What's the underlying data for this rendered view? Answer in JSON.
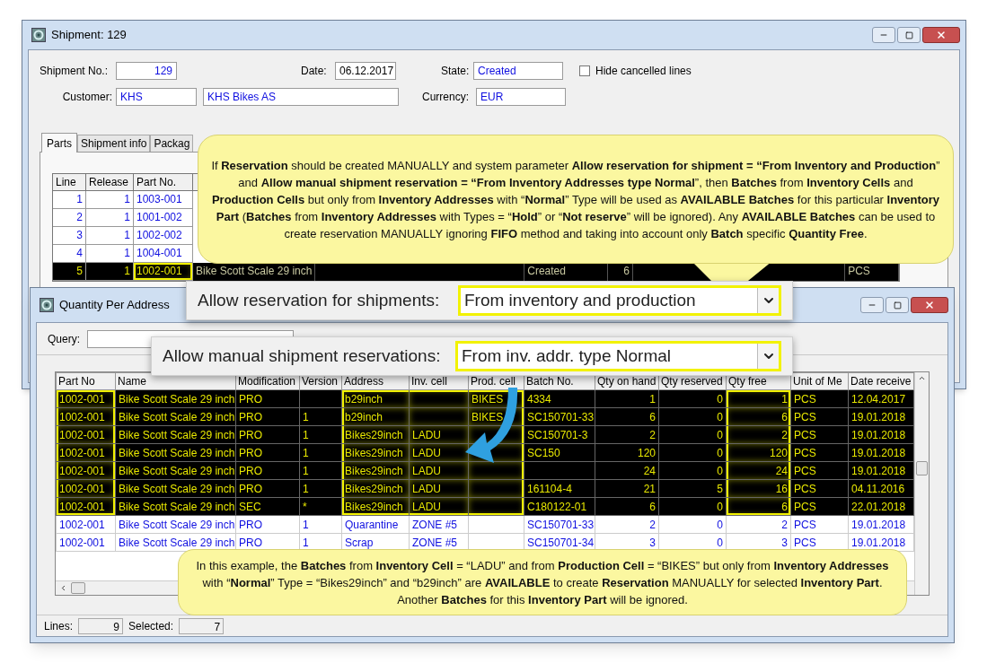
{
  "shipment_window": {
    "title": "Shipment: 129",
    "shipment_no": {
      "label": "Shipment No.:",
      "value": "129"
    },
    "date": {
      "label": "Date:",
      "value": "06.12.2017"
    },
    "state": {
      "label": "State:",
      "value": "Created"
    },
    "hide_cancelled": {
      "label": "Hide cancelled lines",
      "checked": false
    },
    "customer": {
      "label": "Customer:",
      "code": "KHS",
      "name": "KHS Bikes AS"
    },
    "currency": {
      "label": "Currency:",
      "value": "EUR"
    },
    "tabs": [
      {
        "label": "Parts",
        "selected": true
      },
      {
        "label": "Shipment info",
        "selected": false
      },
      {
        "label": "Packag",
        "selected": false
      }
    ],
    "table": {
      "columns": [
        {
          "label": "Line",
          "highlighted": false
        },
        {
          "label": "Release",
          "highlighted": false
        },
        {
          "label": "Part No.",
          "highlighted": true
        }
      ],
      "rows": [
        {
          "line": "1",
          "release": "1",
          "part_no": "1003-001",
          "selected": false
        },
        {
          "line": "2",
          "release": "1",
          "part_no": "1001-002",
          "selected": false
        },
        {
          "line": "3",
          "release": "1",
          "part_no": "1002-002",
          "selected": false
        },
        {
          "line": "4",
          "release": "1",
          "part_no": "1004-001",
          "selected": false
        },
        {
          "line": "5",
          "release": "1",
          "part_no": "1002-001",
          "name": "Bike Scott Scale 29 inch",
          "state": "Created",
          "qty": "6",
          "unit": "PCS",
          "selected": true
        }
      ]
    }
  },
  "quantity_window": {
    "title": "Quantity Per Address",
    "query_label": "Query:",
    "columns": [
      {
        "label": "Part No",
        "highlighted": true
      },
      {
        "label": "Name",
        "highlighted": false
      },
      {
        "label": "Modification",
        "highlighted": false
      },
      {
        "label": "Version",
        "highlighted": false
      },
      {
        "label": "Address",
        "highlighted": true
      },
      {
        "label": "Inv. cell",
        "highlighted": true
      },
      {
        "label": "Prod. cell",
        "highlighted": true
      },
      {
        "label": "Batch No.",
        "highlighted": false
      },
      {
        "label": "Qty on hand",
        "highlighted": false
      },
      {
        "label": "Qty reserved",
        "highlighted": false
      },
      {
        "label": "Qty free",
        "highlighted": true
      },
      {
        "label": "Unit of Me",
        "highlighted": false
      },
      {
        "label": "Date receive",
        "highlighted": false
      }
    ],
    "rows": [
      {
        "part_no": "1002-001",
        "name": "Bike Scott Scale 29 inch",
        "modification": "PRO",
        "address": "b29inch",
        "prod_cell": "BIKES",
        "batch_no": "4334",
        "qty_on_hand": "1",
        "qty_reserved": "0",
        "qty_free": "1",
        "unit": "PCS",
        "date_received": "12.04.2017",
        "selected": true
      },
      {
        "part_no": "1002-001",
        "name": "Bike Scott Scale 29 inch",
        "modification": "PRO",
        "version": "1",
        "address": "b29inch",
        "prod_cell": "BIKES",
        "batch_no": "SC150701-33",
        "qty_on_hand": "6",
        "qty_reserved": "0",
        "qty_free": "6",
        "unit": "PCS",
        "date_received": "19.01.2018",
        "selected": true
      },
      {
        "part_no": "1002-001",
        "name": "Bike Scott Scale 29 inch",
        "modification": "PRO",
        "version": "1",
        "address": "Bikes29inch",
        "inv_cell": "LADU",
        "batch_no": "SC150701-3",
        "qty_on_hand": "2",
        "qty_reserved": "0",
        "qty_free": "2",
        "unit": "PCS",
        "date_received": "19.01.2018",
        "selected": true
      },
      {
        "part_no": "1002-001",
        "name": "Bike Scott Scale 29 inch",
        "modification": "PRO",
        "version": "1",
        "address": "Bikes29inch",
        "inv_cell": "LADU",
        "batch_no": "SC150",
        "qty_on_hand": "120",
        "qty_reserved": "0",
        "qty_free": "120",
        "unit": "PCS",
        "date_received": "19.01.2018",
        "selected": true
      },
      {
        "part_no": "1002-001",
        "name": "Bike Scott Scale 29 inch",
        "modification": "PRO",
        "version": "1",
        "address": "Bikes29inch",
        "inv_cell": "LADU",
        "qty_on_hand": "24",
        "qty_reserved": "0",
        "qty_free": "24",
        "unit": "PCS",
        "date_received": "19.01.2018",
        "selected": true
      },
      {
        "part_no": "1002-001",
        "name": "Bike Scott Scale 29 inch",
        "modification": "PRO",
        "version": "1",
        "address": "Bikes29inch",
        "inv_cell": "LADU",
        "batch_no": "161104-4",
        "qty_on_hand": "21",
        "qty_reserved": "5",
        "qty_free": "16",
        "unit": "PCS",
        "date_received": "04.11.2016",
        "selected": true
      },
      {
        "part_no": "1002-001",
        "name": "Bike Scott Scale 29 inch",
        "modification": "SEC",
        "version": "*",
        "address": "Bikes29inch",
        "inv_cell": "LADU",
        "batch_no": "C180122-01",
        "qty_on_hand": "6",
        "qty_reserved": "0",
        "qty_free": "6",
        "unit": "PCS",
        "date_received": "22.01.2018",
        "selected": true
      },
      {
        "part_no": "1002-001",
        "name": "Bike Scott Scale 29 inch",
        "modification": "PRO",
        "version": "1",
        "address": "Quarantine",
        "inv_cell": "ZONE #5",
        "batch_no": "SC150701-33",
        "qty_on_hand": "2",
        "qty_reserved": "0",
        "qty_free": "2",
        "unit": "PCS",
        "date_received": "19.01.2018",
        "selected": false
      },
      {
        "part_no": "1002-001",
        "name": "Bike Scott Scale 29 inch",
        "modification": "PRO",
        "version": "1",
        "address": "Scrap",
        "inv_cell": "ZONE #5",
        "batch_no": "SC150701-34",
        "qty_on_hand": "3",
        "qty_reserved": "0",
        "qty_free": "3",
        "unit": "PCS",
        "date_received": "19.01.2018",
        "selected": false
      }
    ],
    "status": {
      "lines_label": "Lines:",
      "lines": "9",
      "selected_label": "Selected:",
      "selected": "7"
    }
  },
  "settings": [
    {
      "label": "Allow reservation for shipments:",
      "value": "From inventory and production"
    },
    {
      "label": "Allow manual shipment reservations:",
      "value": "From inv. addr. type Normal"
    }
  ],
  "callouts": [
    {
      "text": "If **Reservation** should be created MANUALLY and system parameter **Allow reservation for shipment = “From Inventory and Production**” and **Allow manual shipment reservation = “From Inventory Addresses type Normal**”, then **Batches** from **Inventory Cells** and **Production  Cells** but only from **Inventory Addresses** with “**Normal**” Type will be used as **AVAILABLE Batches** for this particular **Inventory Part** (**Batches** from **Inventory Addresses** with Types = “**Hold**” or “**Not reserve**” will be ignored). Any **AVAILABLE Batches** can be used to create reservation MANUALLY ignoring **FIFO** method and taking into account only **Batch** specific **Quantity Free**."
    },
    {
      "text": "In this example, the **Batches** from **Inventory Cell** = “LADU” and from **Production Cell** = “BIKES” but only from **Inventory Addresses** with “**Normal**” Type = “Bikes29inch” and “b29inch” are **AVAILABLE** to create **Reservation** MANUALLY for selected **Inventory Part**.  Another **Batches** for this **Inventory Part** will be ignored."
    }
  ]
}
